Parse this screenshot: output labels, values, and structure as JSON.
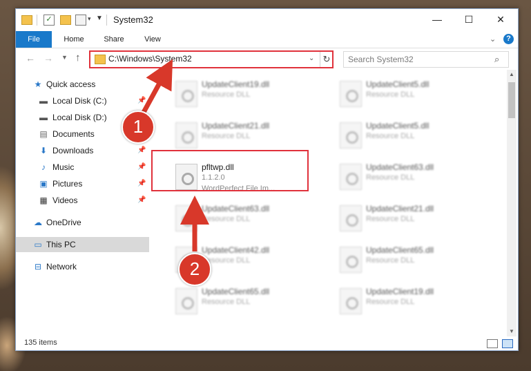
{
  "window": {
    "title": "System32",
    "min_glyph": "—",
    "max_glyph": "☐",
    "close_glyph": "✕"
  },
  "ribbon": {
    "tabs": [
      "File",
      "Home",
      "Share",
      "View"
    ],
    "help_glyph": "?"
  },
  "address": {
    "path": "C:\\Windows\\System32"
  },
  "search": {
    "placeholder": "Search System32"
  },
  "sidebar": {
    "items": [
      {
        "label": "Quick access",
        "icon": "star-icon"
      },
      {
        "label": "Local Disk (C:)",
        "icon": "drive-icon"
      },
      {
        "label": "Local Disk (D:)",
        "icon": "drive-icon"
      },
      {
        "label": "Documents",
        "icon": "documents-icon"
      },
      {
        "label": "Downloads",
        "icon": "download-icon"
      },
      {
        "label": "Music",
        "icon": "music-icon"
      },
      {
        "label": "Pictures",
        "icon": "pictures-icon"
      },
      {
        "label": "Videos",
        "icon": "videos-icon"
      },
      {
        "label": "OneDrive",
        "icon": "cloud-icon"
      },
      {
        "label": "This PC",
        "icon": "computer-icon"
      },
      {
        "label": "Network",
        "icon": "network-icon"
      }
    ]
  },
  "files": {
    "left": [
      {
        "name": "UpdateClient19.dll",
        "desc": "Resource DLL"
      },
      {
        "name": "UpdateClient21.dll",
        "desc": "Resource DLL"
      },
      {
        "name": "pfltwp.dll",
        "desc": "1.1.2.0",
        "desc2": "WordPerfect File Im..."
      },
      {
        "name": "UpdateClient63.dll",
        "desc": "Resource DLL"
      },
      {
        "name": "UpdateClient42.dll",
        "desc": "Resource DLL"
      },
      {
        "name": "UpdateClient65.dll",
        "desc": "Resource DLL"
      }
    ],
    "right": [
      {
        "name": "UpdateClient5.dll",
        "desc": "Resource DLL"
      },
      {
        "name": "UpdateClient5.dll",
        "desc": "Resource DLL"
      },
      {
        "name": "UpdateClient63.dll",
        "desc": "Resource DLL"
      },
      {
        "name": "UpdateClient21.dll",
        "desc": "Resource DLL"
      },
      {
        "name": "UpdateClient65.dll",
        "desc": "Resource DLL"
      },
      {
        "name": "UpdateClient19.dll",
        "desc": "Resource DLL"
      }
    ]
  },
  "status": {
    "item_count": "135 items"
  },
  "annotations": {
    "step1": "1",
    "step2": "2",
    "color": "#d8382a"
  },
  "colors": {
    "accent": "#1979ca",
    "highlight_border": "#e0313b"
  }
}
